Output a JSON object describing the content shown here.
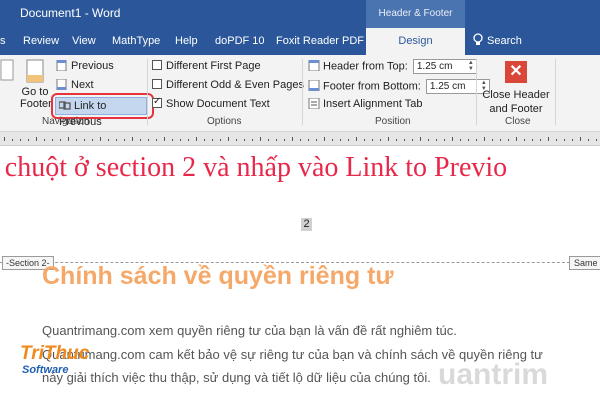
{
  "titlebar": {
    "doc_title": "Document1  -  Word",
    "context_tools": "Header & Footer Tools"
  },
  "tabs": [
    {
      "label": "s"
    },
    {
      "label": "Review"
    },
    {
      "label": "View"
    },
    {
      "label": "MathType"
    },
    {
      "label": "Help"
    },
    {
      "label": "doPDF 10"
    },
    {
      "label": "Foxit Reader PDF"
    },
    {
      "label": "Design"
    },
    {
      "label": "Search"
    }
  ],
  "ribbon": {
    "navigation": {
      "go_to_line1": "Go to",
      "go_to_line2": "Footer",
      "previous": "Previous",
      "next": "Next",
      "link_to_previous": "Link to Previous",
      "label": "Navigation"
    },
    "options": {
      "different_first_page": "Different First Page",
      "different_odd_even": "Different Odd & Even Pages",
      "show_document_text": "Show Document Text",
      "show_document_text_checked": true,
      "label": "Options"
    },
    "position": {
      "header_from_top_label": "Header from Top:",
      "header_from_top_value": "1.25 cm",
      "footer_from_bottom_label": "Footer from Bottom:",
      "footer_from_bottom_value": "1.25 cm",
      "insert_alignment_tab": "Insert Alignment Tab",
      "label": "Position"
    },
    "close": {
      "line1": "Close Header",
      "line2": "and Footer",
      "label": "Close"
    }
  },
  "document": {
    "overlay_instruction": "t chuột ở section 2 và nhấp vào Link to Previo",
    "page_number": "2",
    "section_tag": "-Section 2-",
    "same_as_previous": "Same a",
    "heading": "Chính sách về quyền riêng tư",
    "paragraphs": [
      "Quantrimang.com xem quyền riêng tư của bạn là vấn đề rất nghiêm túc.",
      "Quantrimang.com cam kết bảo vệ sự riêng tư của bạn và chính sách về quyền riêng tư",
      "này giải thích việc thu thập, sử dụng và tiết lộ dữ liệu của chúng tôi."
    ]
  },
  "watermark": {
    "logo_line1": "TriThuc",
    "logo_line2": "Software",
    "site": "uantrim"
  },
  "colors": {
    "brand": "#2b579a",
    "highlight": "#e8323c",
    "overlay_text": "#e8284a",
    "heading": "#f5a868"
  }
}
